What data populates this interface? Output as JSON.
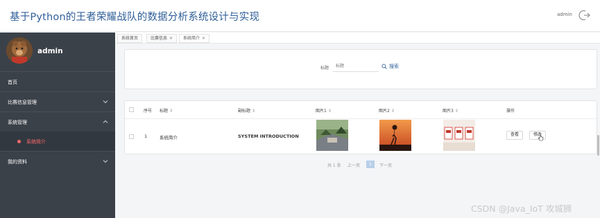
{
  "header": {
    "title": "基于Python的王者荣耀战队的数据分析系统设计与实现",
    "user_label": "admin",
    "logout_icon": "logout-icon"
  },
  "sidebar": {
    "user_name": "admin",
    "items": [
      {
        "label": "首页"
      },
      {
        "label": "比赛信息管理"
      },
      {
        "label": "系统管理"
      },
      {
        "label": "系统简介"
      },
      {
        "label": "我的资料"
      }
    ]
  },
  "tabs": [
    {
      "label": "系统首页"
    },
    {
      "label": "比赛信息"
    },
    {
      "label": "系统简介"
    }
  ],
  "search": {
    "label": "标题",
    "placeholder": "标题",
    "button_label": "搜索"
  },
  "table": {
    "headers": [
      "序号",
      "标题",
      "副标题",
      "图片1",
      "图片2",
      "图片3",
      "操作"
    ],
    "rows": [
      {
        "index": "1",
        "title": "系统简介",
        "subtitle": "SYSTEM INTRODUCTION",
        "view_label": "查看",
        "edit_label": "修改"
      }
    ]
  },
  "pagination": {
    "total": "共 1 条",
    "prev": "上一页",
    "current": "1",
    "next": "下一页"
  },
  "watermark": "CSDN @Java_IoT 攻城狮",
  "colors": {
    "accent": "#2f5f99",
    "sidebar_bg": "#3b4149",
    "active_menu": "#ff6a6a"
  }
}
